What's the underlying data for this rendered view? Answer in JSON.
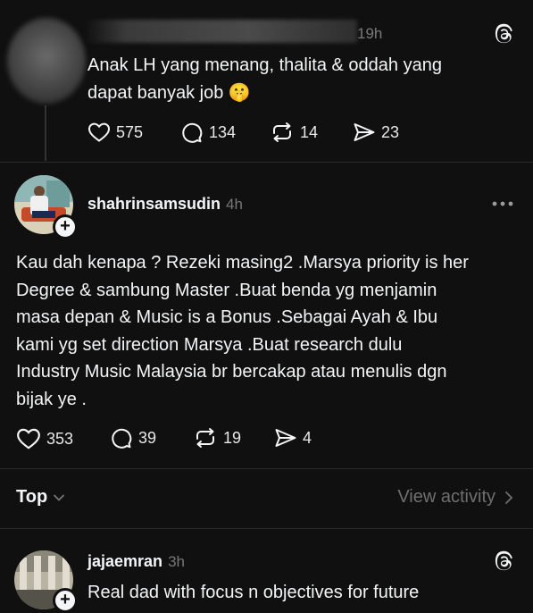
{
  "post1": {
    "time": "19h",
    "text_line1": "Anak LH yang menang, thalita & oddah yang",
    "text_line2": "dapat banyak job",
    "emoji": "🤫",
    "likes": "575",
    "replies": "134",
    "reposts": "14",
    "shares": "23"
  },
  "post2": {
    "username": "shahrinsamsudin",
    "time": "4h",
    "lines": [
      "Kau dah kenapa ? Rezeki masing2 .Marsya priority is her",
      "Degree & sambung Master .Buat benda yg menjamin",
      "masa depan & Music is a Bonus .Sebagai Ayah & Ibu",
      "kami yg set direction Marsya .Buat research dulu",
      "Industry Music Malaysia br bercakap atau menulis dgn",
      "bijak ye ."
    ],
    "likes": "353",
    "replies": "39",
    "reposts": "19",
    "shares": "4"
  },
  "sort": {
    "label": "Top",
    "activity_label": "View activity"
  },
  "post3": {
    "username": "jajaemran",
    "time": "3h",
    "text": "Real dad with focus n objectives for future"
  },
  "icons": [
    "threads-icon",
    "heart-icon",
    "comment-icon",
    "repost-icon",
    "share-icon",
    "more-icon",
    "chevron-down-icon",
    "chevron-right-icon",
    "plus-icon"
  ]
}
